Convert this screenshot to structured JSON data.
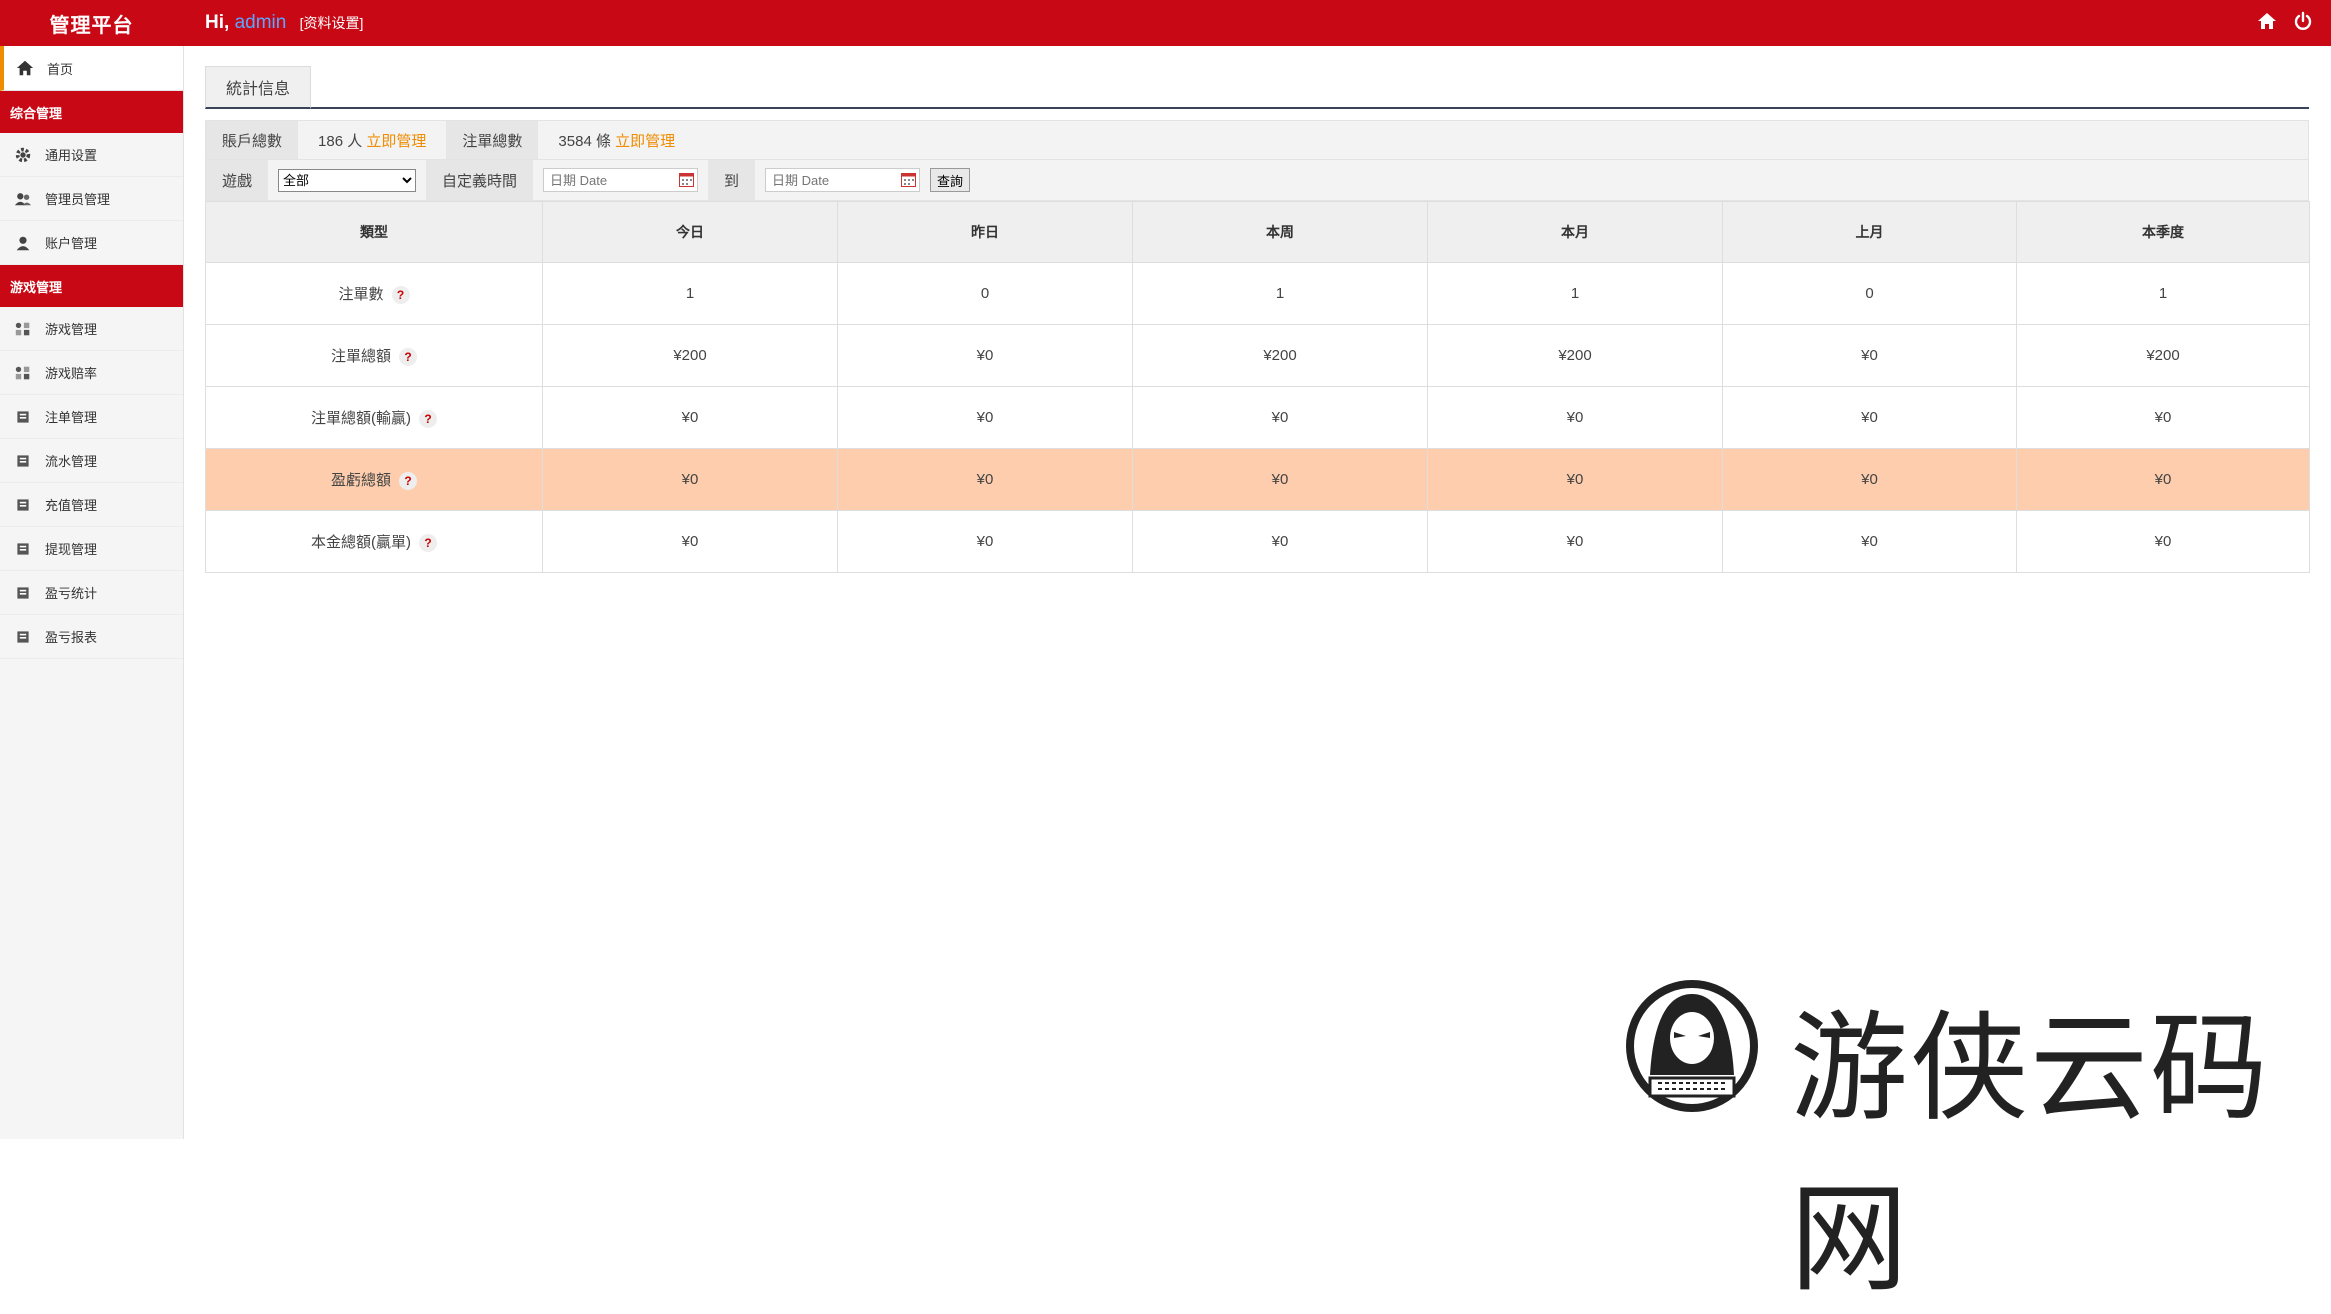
{
  "header": {
    "brand": "管理平台",
    "greeting": "Hi,",
    "username": "admin",
    "profile_link": "[资料设置]",
    "colors": {
      "bar": "#c90816",
      "username": "#59a6ff"
    }
  },
  "sidebar": {
    "home": {
      "label": "首页",
      "icon": "home-icon"
    },
    "groups": [
      {
        "title": "综合管理",
        "items": [
          {
            "label": "通用设置",
            "icon": "gear-icon"
          },
          {
            "label": "管理员管理",
            "icon": "users-icon"
          },
          {
            "label": "账户管理",
            "icon": "user-icon"
          }
        ]
      },
      {
        "title": "游戏管理",
        "items": [
          {
            "label": "游戏管理",
            "icon": "grid-icon"
          },
          {
            "label": "游戏赔率",
            "icon": "grid-icon"
          },
          {
            "label": "注单管理",
            "icon": "list-icon"
          },
          {
            "label": "流水管理",
            "icon": "list-icon"
          },
          {
            "label": "充值管理",
            "icon": "list-icon"
          },
          {
            "label": "提现管理",
            "icon": "list-icon"
          },
          {
            "label": "盈亏统计",
            "icon": "list-icon"
          },
          {
            "label": "盈亏报表",
            "icon": "list-icon"
          }
        ]
      }
    ]
  },
  "main": {
    "tab": "統計信息",
    "summary": {
      "accounts_label": "賬戶總數",
      "accounts_value": "186 人",
      "accounts_link": "立即管理",
      "bets_label": "注單總數",
      "bets_value": "3584 條",
      "bets_link": "立即管理"
    },
    "filter": {
      "game_label": "遊戲",
      "game_selected": "全部",
      "custom_label": "自定義時間",
      "date_placeholder": "日期 Date",
      "to_label": "到",
      "query_button": "查詢"
    },
    "table": {
      "headers": [
        "類型",
        "今日",
        "昨日",
        "本周",
        "本月",
        "上月",
        "本季度"
      ],
      "rows": [
        {
          "label": "注單數",
          "values": [
            "1",
            "0",
            "1",
            "1",
            "0",
            "1"
          ]
        },
        {
          "label": "注單總額",
          "values": [
            "¥200",
            "¥0",
            "¥200",
            "¥200",
            "¥0",
            "¥200"
          ]
        },
        {
          "label": "注單總額(輸贏)",
          "values": [
            "¥0",
            "¥0",
            "¥0",
            "¥0",
            "¥0",
            "¥0"
          ]
        },
        {
          "label": "盈虧總額",
          "values": [
            "¥0",
            "¥0",
            "¥0",
            "¥0",
            "¥0",
            "¥0"
          ],
          "highlight": true
        },
        {
          "label": "本金總額(贏單)",
          "values": [
            "¥0",
            "¥0",
            "¥0",
            "¥0",
            "¥0",
            "¥0"
          ]
        }
      ],
      "help_mark": "?",
      "highlight_color": "#fdcdad"
    }
  },
  "watermark": {
    "text": "游侠云码网"
  }
}
